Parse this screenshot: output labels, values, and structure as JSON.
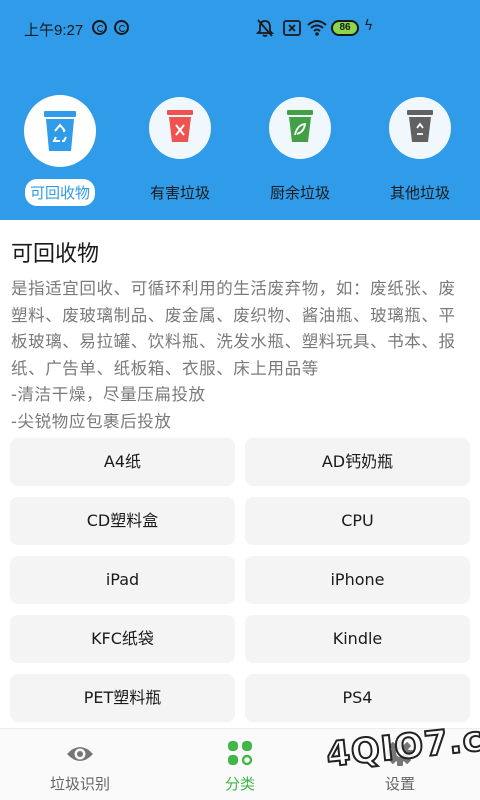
{
  "status_bar": {
    "time": "上午9:27",
    "battery": "86"
  },
  "categories": [
    {
      "label": "可回收物",
      "color": "#2f9be9",
      "icon": "recycle-icon"
    },
    {
      "label": "有害垃圾",
      "color": "#ef5350",
      "icon": "hazard-icon"
    },
    {
      "label": "厨余垃圾",
      "color": "#43a047",
      "icon": "leaf-icon"
    },
    {
      "label": "其他垃圾",
      "color": "#616161",
      "icon": "recycle-icon"
    }
  ],
  "section": {
    "title": "可回收物",
    "desc_lines": [
      "是指适宜回收、可循环利用的生活废弃物，如：废纸张、废",
      "塑料、废玻璃制品、废金属、废织物、酱油瓶、玻璃瓶、平",
      "板玻璃、易拉罐、饮料瓶、洗发水瓶、塑料玩具、书本、报",
      "纸、广告单、纸板箱、衣服、床上用品等",
      "-清洁干燥，尽量压扁投放",
      "-尖锐物应包裹后投放"
    ]
  },
  "items": [
    "A4纸",
    "AD钙奶瓶",
    "CD塑料盒",
    "CPU",
    "iPad",
    "iPhone",
    "KFC纸袋",
    "Kindle",
    "PET塑料瓶",
    "PS4"
  ],
  "bottom_nav": [
    {
      "label": "垃圾识别",
      "icon": "eye-icon"
    },
    {
      "label": "分类",
      "icon": "grid-icon"
    },
    {
      "label": "设置",
      "icon": "gear-icon"
    }
  ],
  "colors": {
    "accent": "#2f9be9",
    "active_nav": "#43b649",
    "inactive_nav": "#666666"
  },
  "watermark": "4QIO7.com"
}
